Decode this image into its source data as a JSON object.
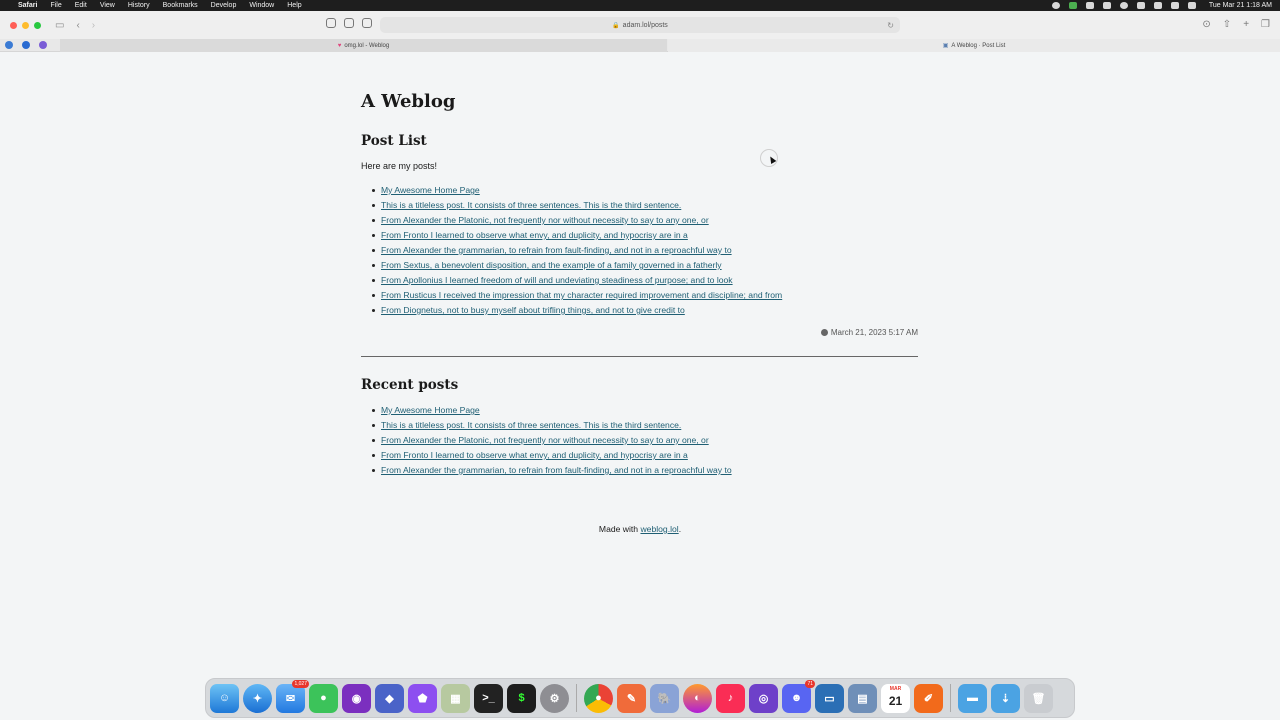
{
  "menubar": {
    "app": "Safari",
    "items": [
      "File",
      "Edit",
      "View",
      "History",
      "Bookmarks",
      "Develop",
      "Window",
      "Help"
    ],
    "clock": "Tue Mar 21  1:18 AM"
  },
  "toolbar": {
    "url": "adam.lol/posts"
  },
  "tabs": [
    {
      "title": "omg.lol - Weblog",
      "favicon": "heart-icon"
    },
    {
      "title": "A Weblog · Post List",
      "favicon": "page-icon"
    }
  ],
  "page": {
    "site_title": "A Weblog",
    "post_list_heading": "Post List",
    "intro": "Here are my posts!",
    "posts": [
      "My Awesome Home Page",
      "This is a titleless post. It consists of three sentences. This is the third sentence.",
      "From Alexander the Platonic, not frequently nor without necessity to say to any one, or",
      "From Fronto I learned to observe what envy, and duplicity, and hypocrisy are in a",
      "From Alexander the grammarian, to refrain from fault-finding, and not in a reproachful way to",
      "From Sextus, a benevolent disposition, and the example of a family governed in a fatherly",
      "From Apollonius I learned freedom of will and undeviating steadiness of purpose; and to look",
      "From Rusticus I received the impression that my character required improvement and discipline; and from",
      "From Diognetus, not to busy myself about trifling things, and not to give credit to"
    ],
    "timestamp": "March 21, 2023 5:17 AM",
    "recent_heading": "Recent posts",
    "recent_posts": [
      "My Awesome Home Page",
      "This is a titleless post. It consists of three sentences. This is the third sentence.",
      "From Alexander the Platonic, not frequently nor without necessity to say to any one, or",
      "From Fronto I learned to observe what envy, and duplicity, and hypocrisy are in a",
      "From Alexander the grammarian, to refrain from fault-finding, and not in a reproachful way to"
    ],
    "footer_prefix": "Made with ",
    "footer_link": "weblog.lol",
    "footer_suffix": "."
  },
  "dock": {
    "mail_badge": "1,027",
    "discord_badge": "71",
    "calendar_month": "MAR",
    "calendar_day": "21"
  },
  "colors": {
    "link": "#1f5f74",
    "background": "#f3f5f6",
    "traffic_red": "#ff5f57",
    "traffic_yellow": "#febc2e",
    "traffic_green": "#28c840"
  }
}
